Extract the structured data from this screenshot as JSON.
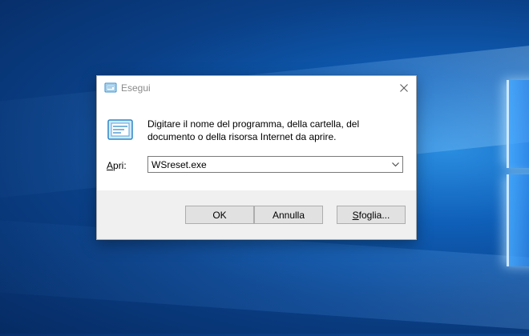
{
  "desktop": {
    "wallpaper": "windows-10-hero",
    "accent": "#0f5fb8"
  },
  "dialog": {
    "title": "Esegui",
    "title_icon": "run-icon",
    "close_icon": "close-icon",
    "description": "Digitare il nome del programma, della cartella, del documento o della risorsa Internet da aprire.",
    "open_label_prefix": "",
    "open_label_mnemonic": "A",
    "open_label_rest": "pri:",
    "open_value": "WSreset.exe",
    "dropdown_icon": "chevron-down-icon",
    "buttons": {
      "ok": "OK",
      "cancel": "Annulla",
      "browse_mnemonic": "S",
      "browse_rest": "foglia..."
    }
  }
}
